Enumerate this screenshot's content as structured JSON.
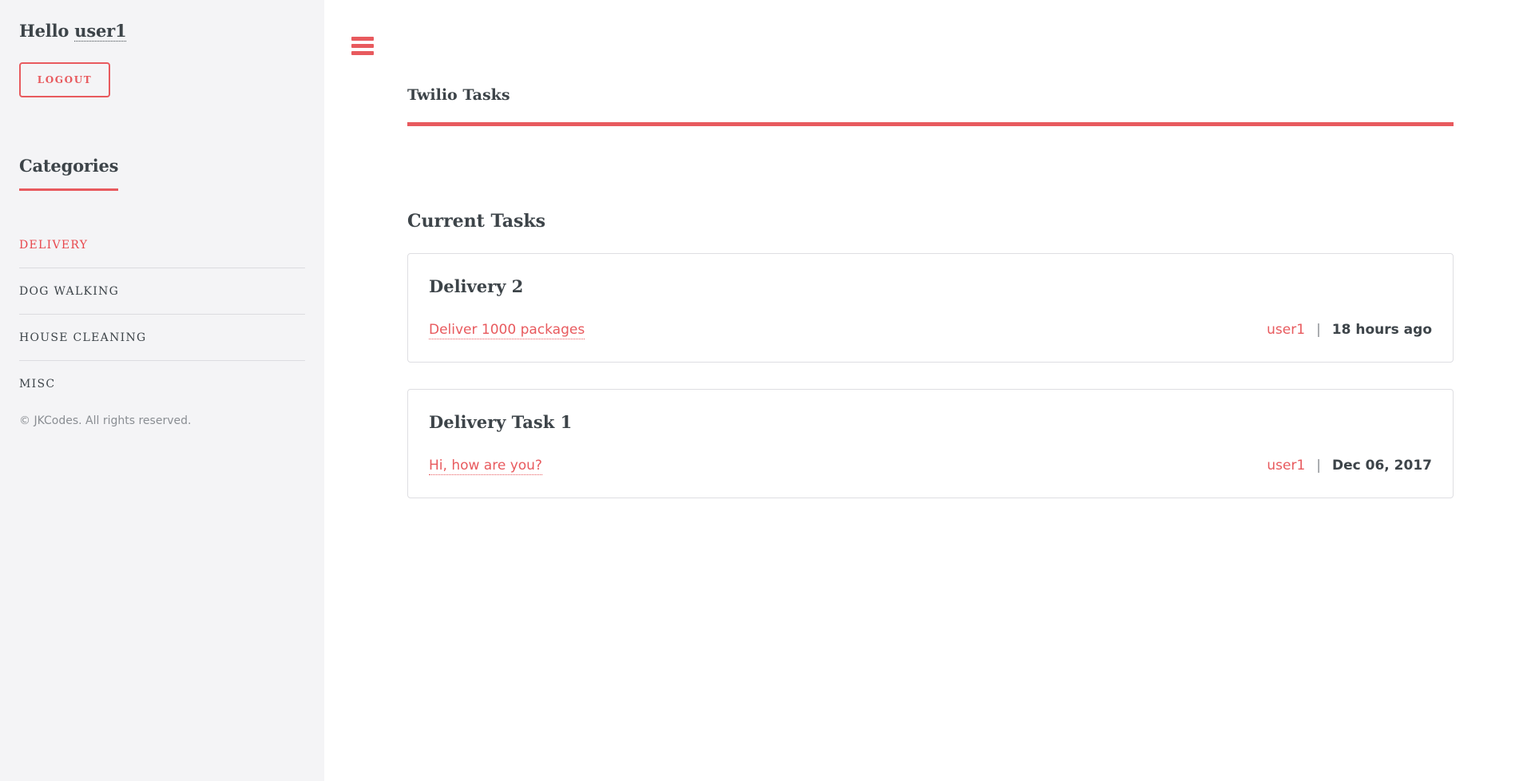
{
  "sidebar": {
    "greeting": "Hello",
    "username": "user1",
    "logout_label": "LOGOUT",
    "categories_title": "Categories",
    "categories": [
      {
        "label": "DELIVERY",
        "active": true
      },
      {
        "label": "DOG WALKING",
        "active": false
      },
      {
        "label": "HOUSE CLEANING",
        "active": false
      },
      {
        "label": "MISC",
        "active": false
      }
    ],
    "copyright": "© JKCodes. All rights reserved."
  },
  "header": {
    "title": "Twilio Tasks"
  },
  "main": {
    "section_title": "Current Tasks",
    "tasks": [
      {
        "title": "Delivery 2",
        "description": "Deliver 1000 packages",
        "user": "user1",
        "separator": "|",
        "time": "18 hours ago"
      },
      {
        "title": "Delivery Task 1",
        "description": "Hi, how are you?",
        "user": "user1",
        "separator": "|",
        "time": "Dec 06, 2017"
      }
    ]
  },
  "icons": {
    "menu": "hamburger-menu-icon"
  },
  "colors": {
    "accent": "#e85a5e",
    "active_category": "#e8474c",
    "sidebar_bg": "#f4f4f6",
    "text": "#3d4449"
  }
}
